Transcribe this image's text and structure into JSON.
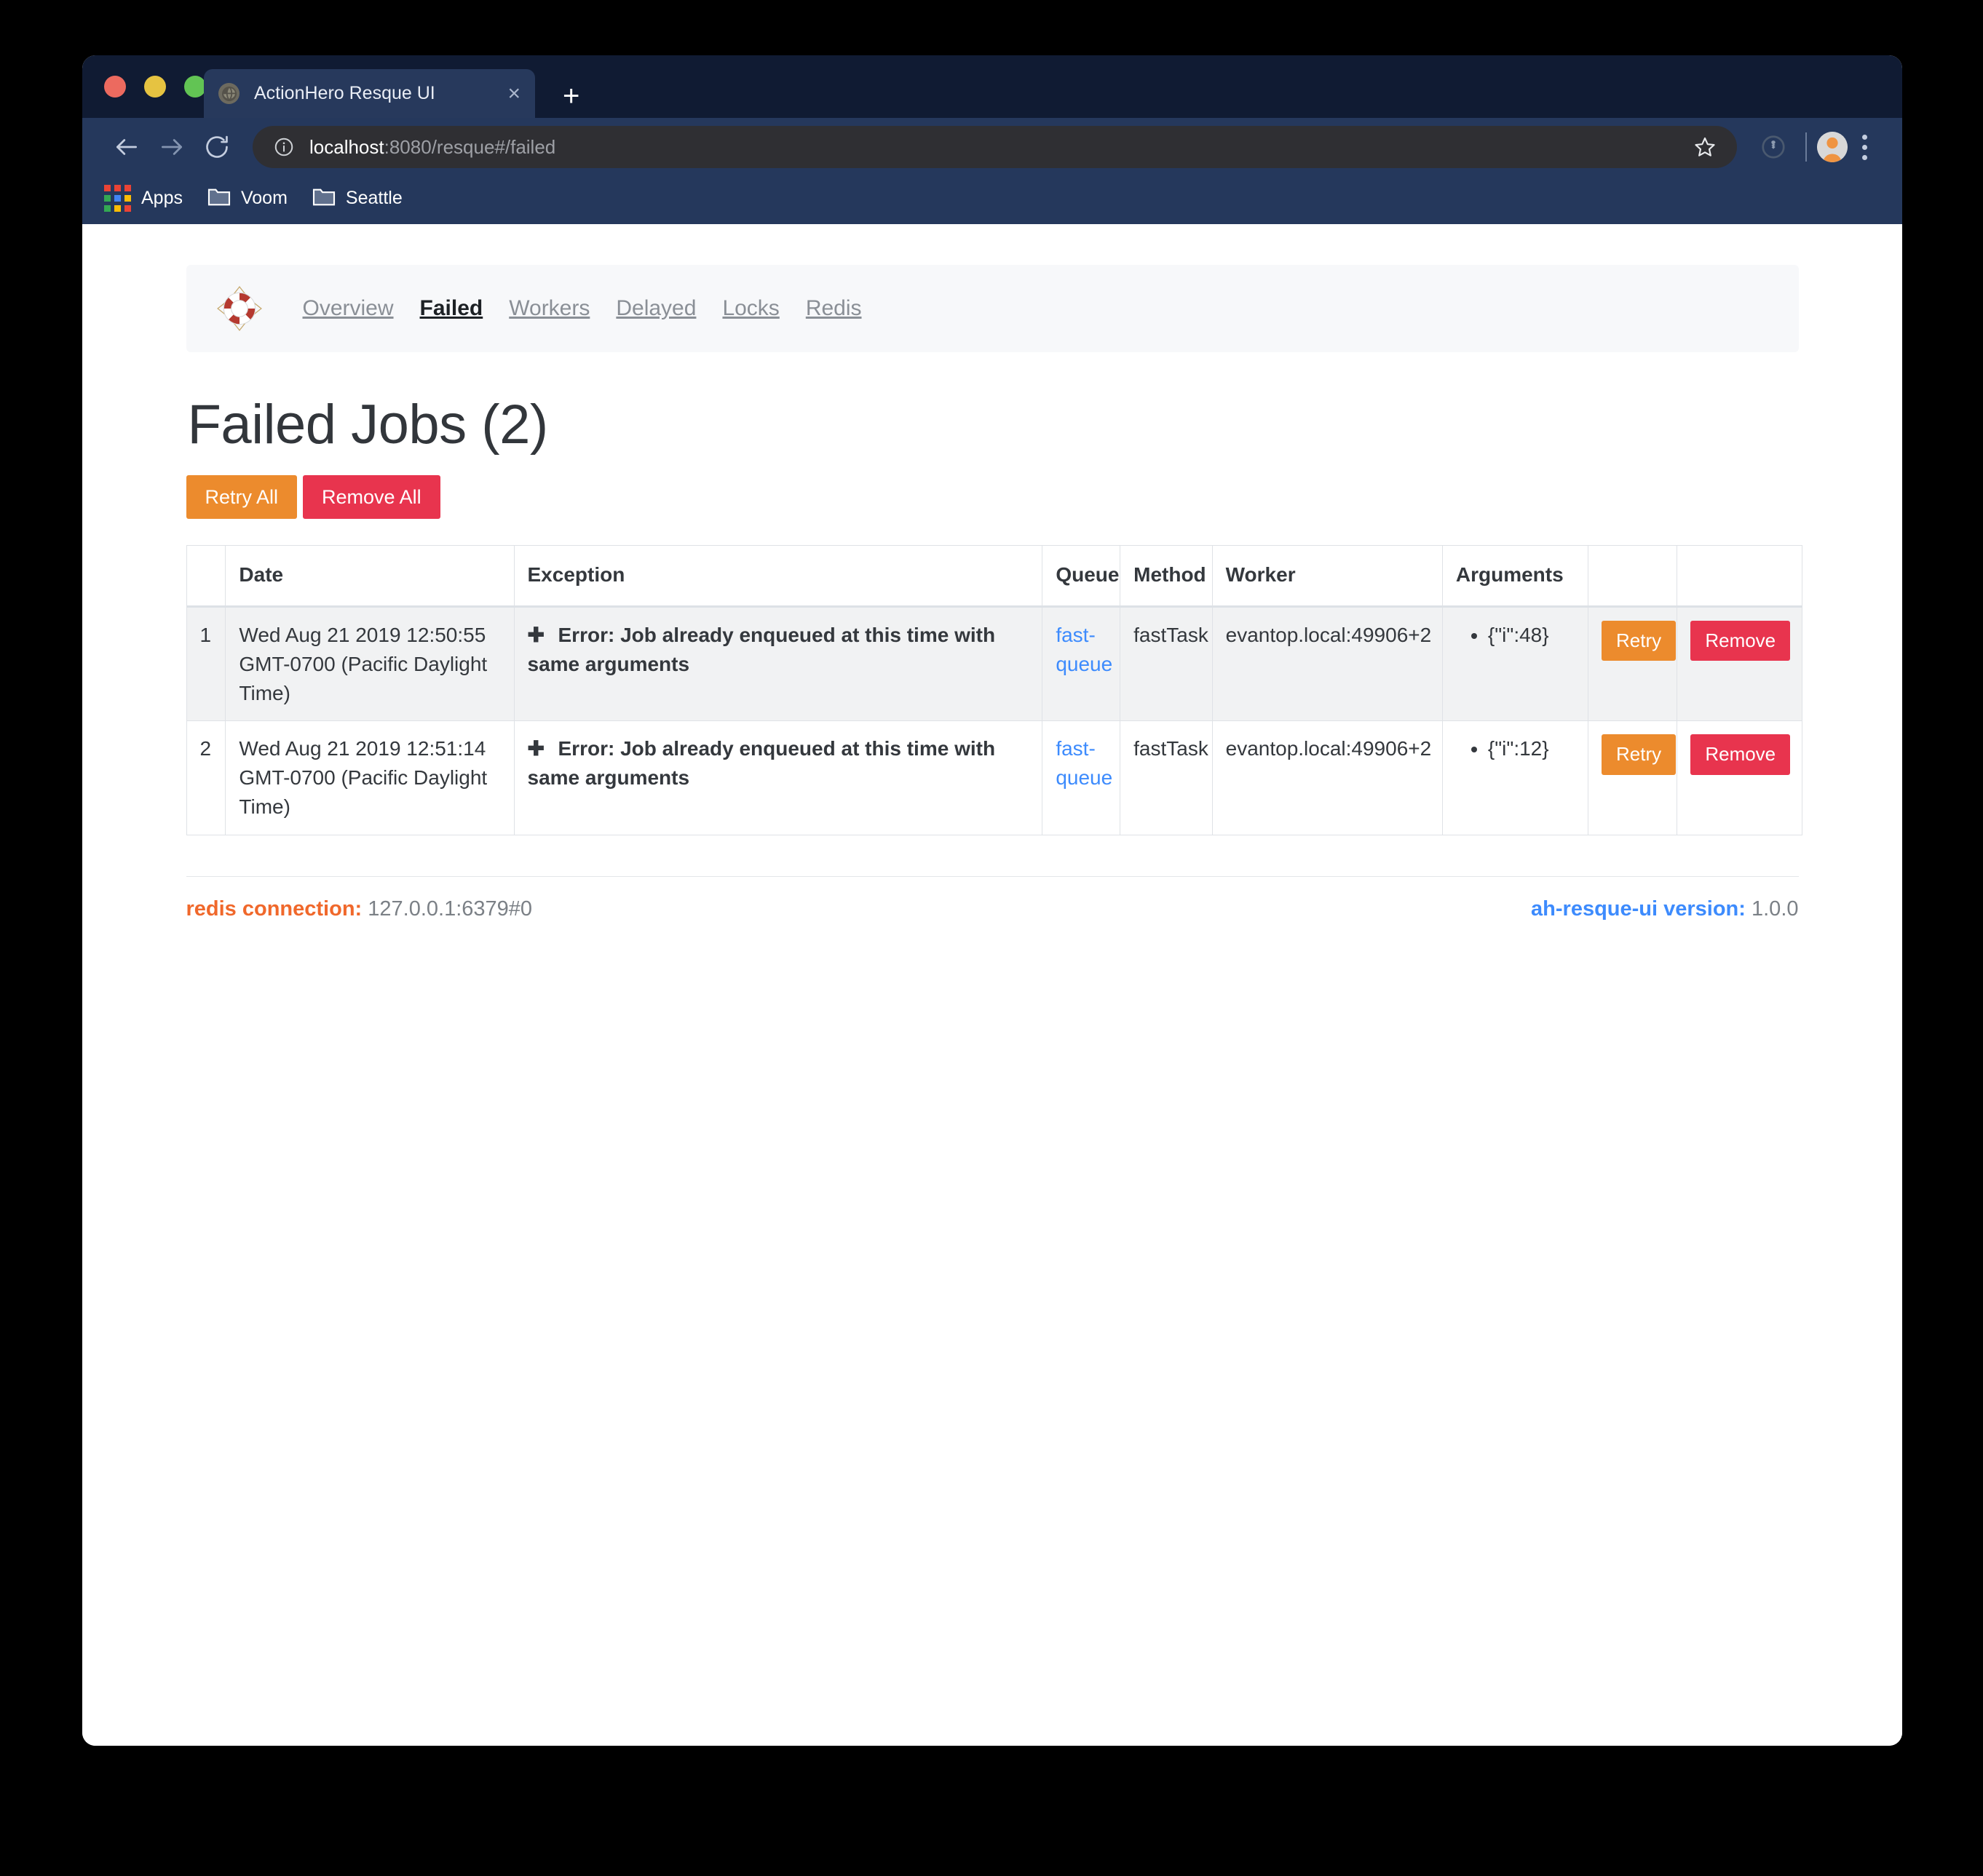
{
  "browser": {
    "tab": {
      "title": "ActionHero Resque UI",
      "favicon": "globe-icon",
      "close": "×"
    },
    "new_tab_label": "+",
    "omnibox": {
      "url_host": "localhost",
      "url_rest": ":8080/resque#/failed",
      "info_icon": "info-circle-icon",
      "star_icon": "star-icon"
    },
    "bookmarks": [
      {
        "label": "Apps",
        "icon": "apps-grid-icon"
      },
      {
        "label": "Voom",
        "icon": "folder-icon"
      },
      {
        "label": "Seattle",
        "icon": "folder-icon"
      }
    ]
  },
  "app": {
    "logo": "life-ring-icon",
    "nav": [
      {
        "label": "Overview",
        "active": false
      },
      {
        "label": "Failed",
        "active": true
      },
      {
        "label": "Workers",
        "active": false
      },
      {
        "label": "Delayed",
        "active": false
      },
      {
        "label": "Locks",
        "active": false
      },
      {
        "label": "Redis",
        "active": false
      }
    ],
    "page_title": "Failed Jobs (2)",
    "actions": {
      "retry_all": "Retry All",
      "remove_all": "Remove All"
    },
    "table": {
      "headers": [
        "",
        "Date",
        "Exception",
        "Queue",
        "Method",
        "Worker",
        "Arguments",
        "",
        ""
      ],
      "rows": [
        {
          "index": "1",
          "date": "Wed Aug 21 2019 12:50:55 GMT-0700 (Pacific Daylight Time)",
          "exception": "Error: Job already enqueued at this time with same arguments",
          "expand_icon": "plus-icon",
          "queue": "fast-queue",
          "method": "fastTask",
          "worker": "evantop.local:49906+2",
          "arguments": [
            "{\"i\":48}"
          ],
          "retry": "Retry",
          "remove": "Remove"
        },
        {
          "index": "2",
          "date": "Wed Aug 21 2019 12:51:14 GMT-0700 (Pacific Daylight Time)",
          "exception": "Error: Job already enqueued at this time with same arguments",
          "expand_icon": "plus-icon",
          "queue": "fast-queue",
          "method": "fastTask",
          "worker": "evantop.local:49906+2",
          "arguments": [
            "{\"i\":12}"
          ],
          "retry": "Retry",
          "remove": "Remove"
        }
      ]
    },
    "footer": {
      "redis_label": "redis connection:",
      "redis_value": "127.0.0.1:6379#0",
      "version_label": "ah-resque-ui version:",
      "version_value": "1.0.0"
    }
  },
  "colors": {
    "orange": "#ec8b2d",
    "red": "#e8344e",
    "link_blue": "#3d8bfd",
    "redis_orange": "#f0682b",
    "chrome_dark": "#101b33",
    "chrome_toolbar": "#25385c"
  }
}
